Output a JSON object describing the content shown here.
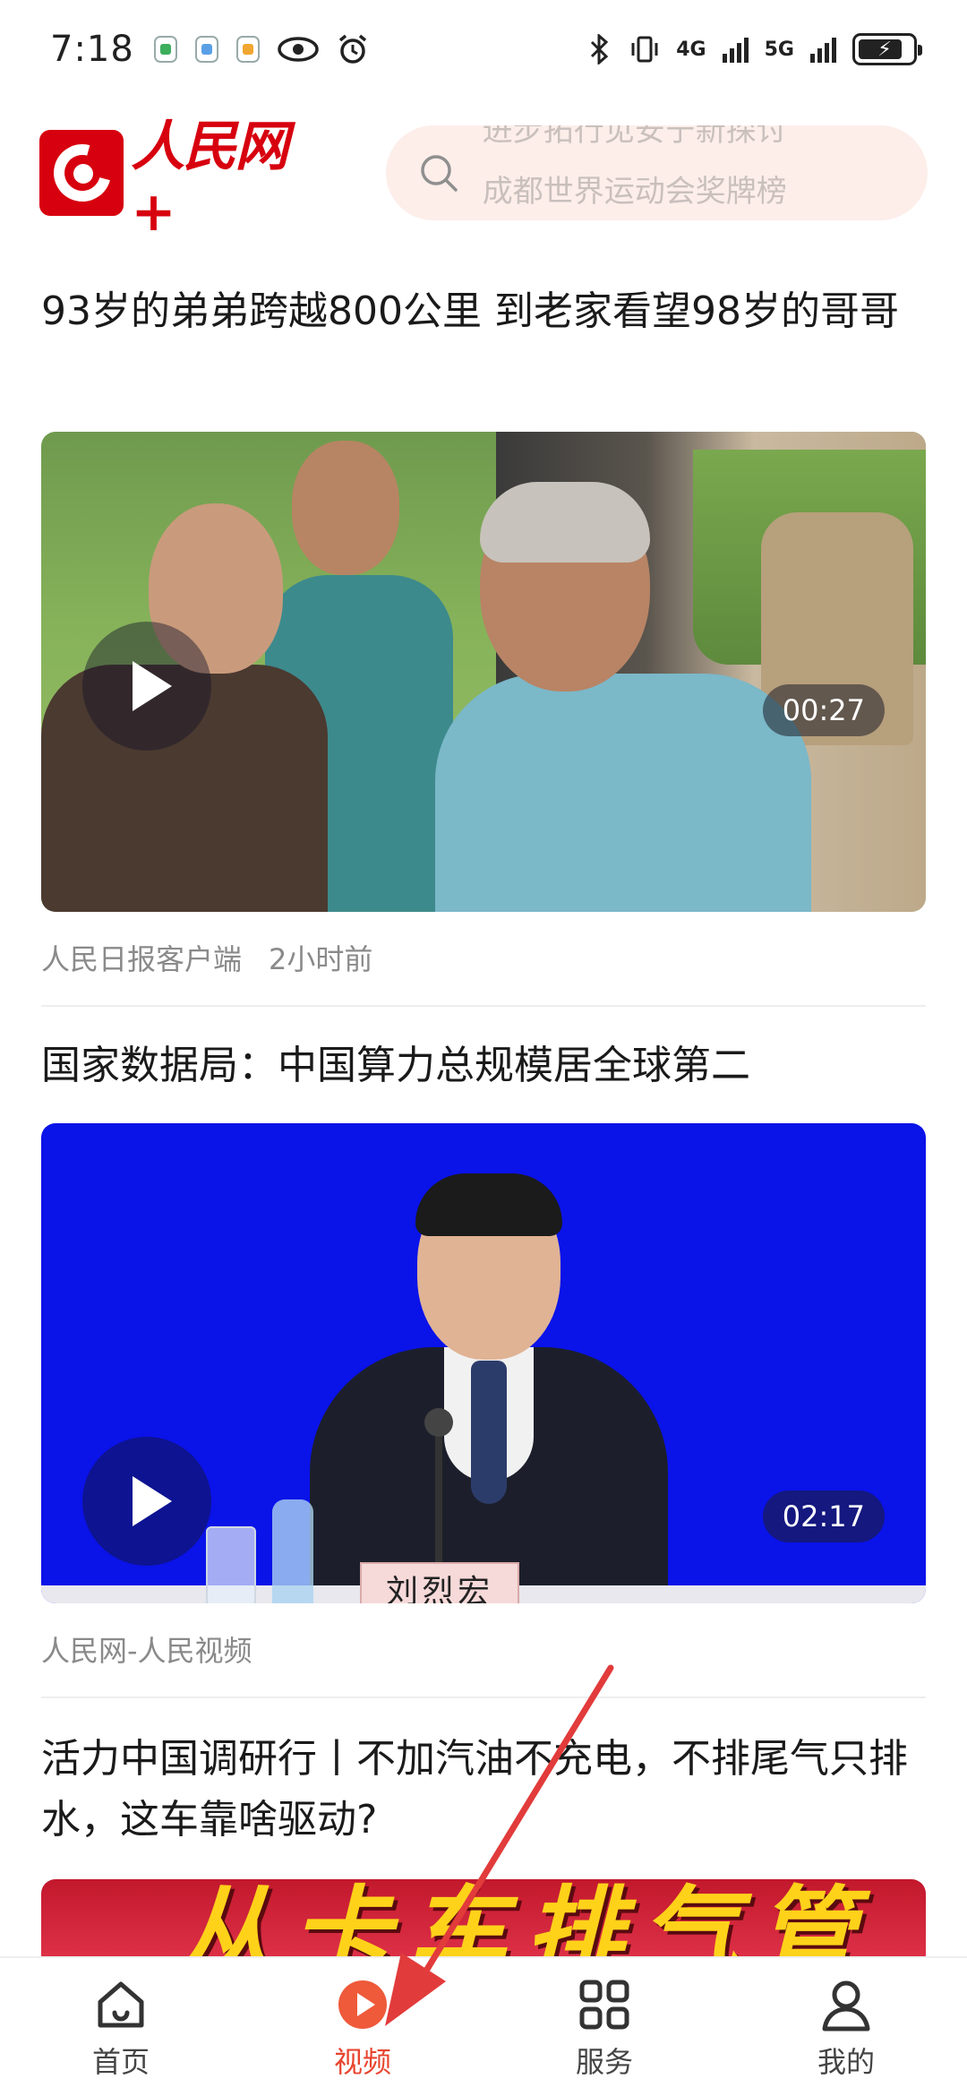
{
  "status_bar": {
    "time": "7:18",
    "net1": "4G",
    "net2": "5G"
  },
  "header": {
    "logo_text": "人民网+",
    "search_hint_prev": "进步拓行见安宁新探讨",
    "search_hint": "成都世界运动会奖牌榜"
  },
  "feed": [
    {
      "title": "93岁的弟弟跨越800公里 到老家看望98岁的哥哥",
      "duration": "00:27",
      "source": "人民日报客户端",
      "time": "2小时前"
    },
    {
      "title": "国家数据局：中国算力总规模居全球第二",
      "duration": "02:17",
      "source": "人民网-人民视频",
      "nameplate": "刘烈宏"
    },
    {
      "title": "活力中国调研行丨不加汽油不充电，不排尾气只排水，这车靠啥驱动?",
      "banner_text": "从卡车排气管"
    }
  ],
  "bottom_nav": {
    "items": [
      {
        "label": "首页",
        "icon": "home-icon"
      },
      {
        "label": "视频",
        "icon": "video-play-icon",
        "active": true
      },
      {
        "label": "服务",
        "icon": "grid-icon"
      },
      {
        "label": "我的",
        "icon": "user-icon"
      }
    ]
  },
  "colors": {
    "brand_red": "#d7000f",
    "active_tab": "#e8442e",
    "annotation_arrow": "#e23b3b"
  }
}
